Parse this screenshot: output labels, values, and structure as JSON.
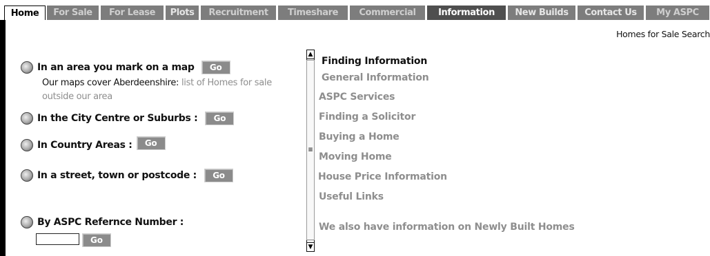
{
  "nav": {
    "tabs": [
      {
        "label": "Home"
      },
      {
        "label": "For Sale"
      },
      {
        "label": "For Lease"
      },
      {
        "label": "Plots"
      },
      {
        "label": "Recruitment"
      },
      {
        "label": "Timeshare"
      },
      {
        "label": "Commercial"
      },
      {
        "label": "Information"
      },
      {
        "label": "New Builds"
      },
      {
        "label": "Contact Us"
      },
      {
        "label": "My ASPC"
      }
    ]
  },
  "header": {
    "search_link": "Homes for Sale Search"
  },
  "search": {
    "map": {
      "label": "In an area you mark on a map",
      "go": "Go",
      "desc": "Our maps cover Aberdeenshire:",
      "link": "list of Homes for sale outside our area"
    },
    "city": {
      "label": "In the City Centre or Suburbs :",
      "go": "Go"
    },
    "country": {
      "label": "In Country Areas :",
      "go": "Go"
    },
    "street": {
      "label": "In a street, town or postcode :",
      "go": "Go"
    },
    "ref": {
      "label": "By ASPC Refernce Number :",
      "go": "Go",
      "value": ""
    }
  },
  "info": {
    "title": "Finding Information",
    "items": [
      "General Information",
      "ASPC Services",
      "Finding a Solicitor",
      "Buying a Home",
      "Moving Home",
      "House Price Information",
      "Useful Links",
      "We also have information on Newly Built Homes"
    ]
  }
}
